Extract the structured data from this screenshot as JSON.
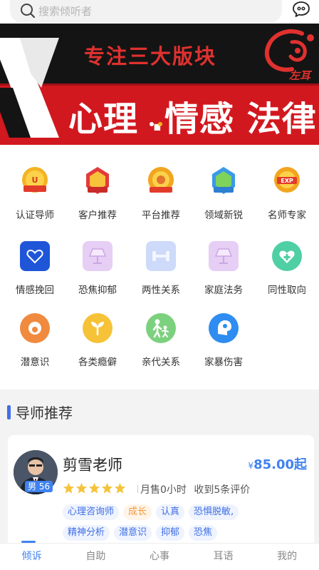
{
  "search": {
    "placeholder": "搜索倾听者",
    "icon": "search-icon"
  },
  "header": {
    "chat_icon": "chat-bubble-icon"
  },
  "banner": {
    "subtitle": "专注三大版块",
    "title": "心理 .情感  法律",
    "brand": "左耳",
    "dots": 2,
    "active_dot": 2
  },
  "categories": [
    {
      "label": "认证导师",
      "icon": "certified-medal-icon"
    },
    {
      "label": "客户推荐",
      "icon": "customer-medal-icon"
    },
    {
      "label": "平台推荐",
      "icon": "platform-medal-icon"
    },
    {
      "label": "领域新锐",
      "icon": "newcomer-medal-icon"
    },
    {
      "label": "名师专家",
      "icon": "expert-medal-icon"
    },
    {
      "label": "情感挽回",
      "icon": "heart-icon"
    },
    {
      "label": "恐焦抑郁",
      "icon": "lamp-icon"
    },
    {
      "label": "两性关系",
      "icon": "dumbbell-icon"
    },
    {
      "label": "家庭法务",
      "icon": "lamp-icon"
    },
    {
      "label": "同性取向",
      "icon": "heart-plus-icon"
    },
    {
      "label": "潜意识",
      "icon": "subconscious-icon"
    },
    {
      "label": "各类瘾僻",
      "icon": "sprout-icon"
    },
    {
      "label": "亲代关系",
      "icon": "parent-child-icon"
    },
    {
      "label": "家暴伤害",
      "icon": "head-icon"
    }
  ],
  "section": {
    "title": "导师推荐"
  },
  "tutor": {
    "name": "剪雪老师",
    "gender_age": "男 56",
    "price_currency": "¥",
    "price": "85.00起",
    "rating": 5,
    "sales": "月售0小时",
    "reviews": "收到5条评价",
    "tags_row1": [
      "心理咨询师",
      "成长",
      "认真",
      "恐惧脱敏,"
    ],
    "tags_row2": [
      "精神分析",
      "潜意识",
      "抑郁",
      "恐焦"
    ]
  },
  "nav": {
    "items": [
      "倾诉",
      "自助",
      "心事",
      "耳语",
      "我的"
    ],
    "active": "倾诉"
  },
  "colors": {
    "accent": "#3f82f0",
    "banner_red": "#d2181f",
    "star": "#f5c33b",
    "tag_orange": "#f29a3a"
  }
}
